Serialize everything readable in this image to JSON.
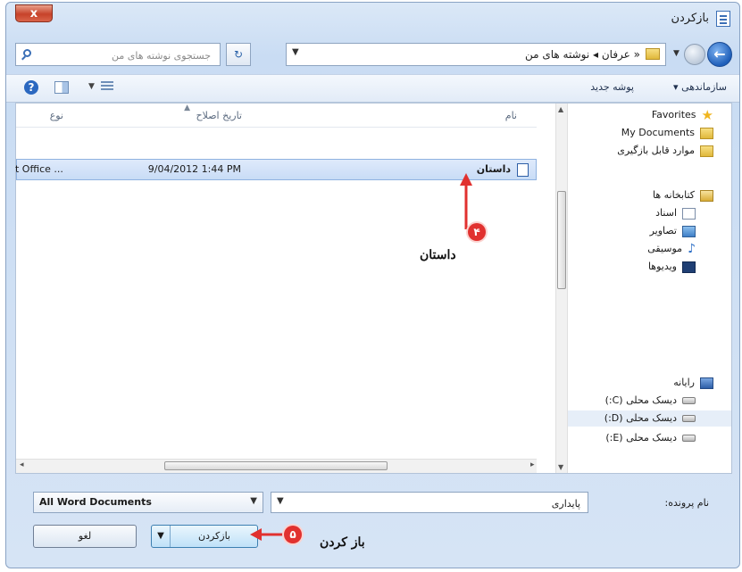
{
  "window": {
    "title": "بازکردن",
    "close_label": "x"
  },
  "nav": {
    "address_path": "« عرفان ◂ نوشته های من",
    "search_placeholder": "جستجوی نوشته های من"
  },
  "toolbar": {
    "organize_label": "سازماندهی ▾",
    "new_folder_label": "پوشه جدید",
    "help_label": "?"
  },
  "sidebar": {
    "items": [
      {
        "label": "Favorites",
        "icon": "star-icon"
      },
      {
        "label": "My Documents",
        "icon": "folder-icon"
      },
      {
        "label": "موارد قابل بازگیری",
        "icon": "folder-icon"
      },
      {
        "label": "کتابخانه ها",
        "icon": "library-icon"
      },
      {
        "label": "اسناد",
        "icon": "document-icon"
      },
      {
        "label": "تصاویر",
        "icon": "pictures-icon"
      },
      {
        "label": "موسیقی",
        "icon": "music-icon"
      },
      {
        "label": "ویدیوها",
        "icon": "video-icon"
      },
      {
        "label": "رایانه",
        "icon": "computer-icon"
      },
      {
        "label": "دیسک محلی (C:)",
        "icon": "drive-icon"
      },
      {
        "label": "دیسک محلی (D:)",
        "icon": "drive-icon",
        "selected": true
      },
      {
        "label": "دیسک محلی (E:)",
        "icon": "drive-icon"
      }
    ]
  },
  "files": {
    "columns": [
      "نام",
      "تاریخ اصلاح",
      "نوع"
    ],
    "rows": [
      {
        "name": "داستان",
        "date": "9/04/2012 1:44 PM",
        "type": "t Office ..."
      }
    ]
  },
  "bottom": {
    "filename_label": "نام پرونده:",
    "filename_value": "پایداری",
    "filetype_value": "All Word Documents",
    "open_label": "بازکردن",
    "cancel_label": "لغو"
  },
  "annotations": {
    "step4_number": "۴",
    "step4_text": "داستان",
    "step5_number": "۵",
    "step5_text": "باز کردن"
  },
  "colors": {
    "annotation_red": "#e1312f",
    "window_frame": "#c9dcf3",
    "selection": "#c8dcf6"
  }
}
